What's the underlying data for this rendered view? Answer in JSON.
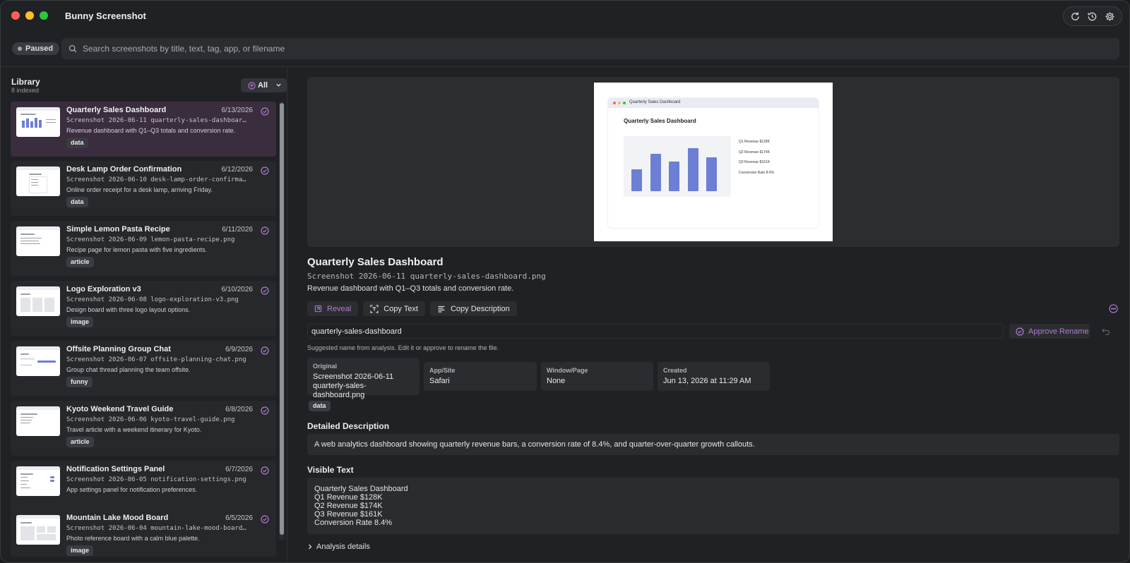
{
  "app": {
    "title": "Bunny Screenshot"
  },
  "status": {
    "label": "Paused"
  },
  "search": {
    "placeholder": "Search screenshots by title, text, tag, app, or filename"
  },
  "library": {
    "title": "Library",
    "count": "8 indexed",
    "filter": "All",
    "items": [
      {
        "title": "Quarterly Sales Dashboard",
        "date": "6/13/2026",
        "file": "Screenshot 2026-06-11 quarterly-sales-dashboard.png",
        "desc": "Revenue dashboard with Q1–Q3 totals and conversion rate.",
        "tag": "data"
      },
      {
        "title": "Desk Lamp Order Confirmation",
        "date": "6/12/2026",
        "file": "Screenshot 2026-06-10 desk-lamp-order-confirmation.p…",
        "desc": "Online order receipt for a desk lamp, arriving Friday.",
        "tag": "data"
      },
      {
        "title": "Simple Lemon Pasta Recipe",
        "date": "6/11/2026",
        "file": "Screenshot 2026-06-09 lemon-pasta-recipe.png",
        "desc": "Recipe page for lemon pasta with five ingredients.",
        "tag": "article"
      },
      {
        "title": "Logo Exploration v3",
        "date": "6/10/2026",
        "file": "Screenshot 2026-06-08 logo-exploration-v3.png",
        "desc": "Design board with three logo layout options.",
        "tag": "image"
      },
      {
        "title": "Offsite Planning Group Chat",
        "date": "6/9/2026",
        "file": "Screenshot 2026-06-07 offsite-planning-chat.png",
        "desc": "Group chat thread planning the team offsite.",
        "tag": "funny"
      },
      {
        "title": "Kyoto Weekend Travel Guide",
        "date": "6/8/2026",
        "file": "Screenshot 2026-06-06 kyoto-travel-guide.png",
        "desc": "Travel article with a weekend itinerary for Kyoto.",
        "tag": "article"
      },
      {
        "title": "Notification Settings Panel",
        "date": "6/7/2026",
        "file": "Screenshot 2026-06-05 notification-settings.png",
        "desc": "App settings panel for notification preferences.",
        "tag": ""
      },
      {
        "title": "Mountain Lake Mood Board",
        "date": "6/5/2026",
        "file": "Screenshot 2026-06-04 mountain-lake-mood-board.png",
        "desc": "Photo reference board with a calm blue palette.",
        "tag": "image"
      }
    ]
  },
  "preview": {
    "window_title": "Quarterly Sales Dashboard",
    "heading": "Quarterly Sales Dashboard",
    "kv": [
      "Q1 Revenue $128K",
      "Q2 Revenue $174K",
      "Q3 Revenue $161K",
      "Conversion Rate 8.4%"
    ]
  },
  "detail": {
    "title": "Quarterly Sales Dashboard",
    "file": "Screenshot 2026-06-11 quarterly-sales-dashboard.png",
    "summary": "Revenue dashboard with Q1–Q3 totals and conversion rate.",
    "actions": {
      "reveal": "Reveal",
      "copy_text": "Copy Text",
      "copy_description": "Copy Description"
    },
    "rename_value": "quarterly-sales-dashboard",
    "approve_label": "Approve Rename",
    "hint": "Suggested name from analysis. Edit it or approve to rename the file.",
    "meta": {
      "original_label": "Original",
      "original_line1": "Screenshot 2026-06-11",
      "original_line2": "quarterly-sales-dashboard.png",
      "app_label": "App/Site",
      "app_value": "Safari",
      "window_label": "Window/Page",
      "window_value": "None",
      "created_label": "Created",
      "created_value": "Jun 13, 2026 at 11:29 AM"
    },
    "tag": "data",
    "detailed_title": "Detailed Description",
    "detailed_text": "A web analytics dashboard showing quarterly revenue bars, a conversion rate of 8.4%, and quarter-over-quarter growth callouts.",
    "visible_title": "Visible Text",
    "visible_lines": [
      "Quarterly Sales Dashboard",
      "Q1 Revenue $128K",
      "Q2 Revenue $174K",
      "Q3 Revenue $161K",
      "Conversion Rate 8.4%"
    ],
    "analysis_label": "Analysis details"
  },
  "colors": {
    "accent": "#b07ccf",
    "selected_row": "#3a2d3e",
    "chart_bar": "#6c7fd4"
  }
}
